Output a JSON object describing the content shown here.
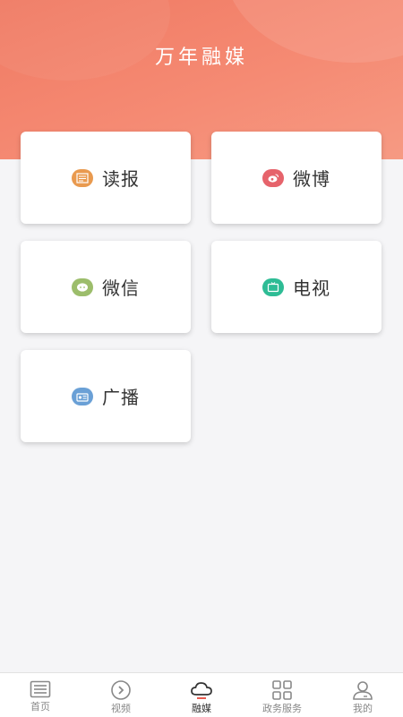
{
  "header": {
    "title": "万年融媒"
  },
  "cards": [
    {
      "label": "读报",
      "icon": "newspaper-icon",
      "color": "#e99a4f"
    },
    {
      "label": "微博",
      "icon": "weibo-icon",
      "color": "#e6636b"
    },
    {
      "label": "微信",
      "icon": "wechat-icon",
      "color": "#9cbd6b"
    },
    {
      "label": "电视",
      "icon": "tv-icon",
      "color": "#2ebc95"
    },
    {
      "label": "广播",
      "icon": "radio-icon",
      "color": "#6aa0d6"
    }
  ],
  "tabbar": {
    "active": "融媒",
    "items": [
      {
        "label": "首页",
        "icon": "news-list-icon"
      },
      {
        "label": "视频",
        "icon": "play-circle-icon"
      },
      {
        "label": "融媒",
        "icon": "cloud-icon"
      },
      {
        "label": "政务服务",
        "icon": "grid-icon"
      },
      {
        "label": "我的",
        "icon": "user-icon"
      }
    ]
  }
}
